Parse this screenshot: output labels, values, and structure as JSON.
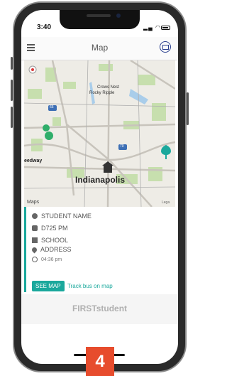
{
  "status_bar": {
    "time": "3:40"
  },
  "header": {
    "title": "Map"
  },
  "map": {
    "city_label": "Indianapolis",
    "places": [
      "Crows Nest",
      "Rocky Ripple",
      "eedway"
    ],
    "highways": [
      "65",
      "70"
    ],
    "watermark": "Maps",
    "legal": "Lega"
  },
  "card": {
    "student_name": "STUDENT NAME",
    "bus": "D725 PM",
    "school": "SCHOOL",
    "address": "ADDRESS",
    "time": "04:36 pm",
    "see_map_label": "SEE MAP",
    "track_label": "Track bus on map"
  },
  "brand": {
    "name": "FIRSTstudent"
  },
  "step": "4",
  "colors": {
    "accent": "#1aa89c",
    "badge": "#e74c2d",
    "mail": "#2a3f8f"
  }
}
